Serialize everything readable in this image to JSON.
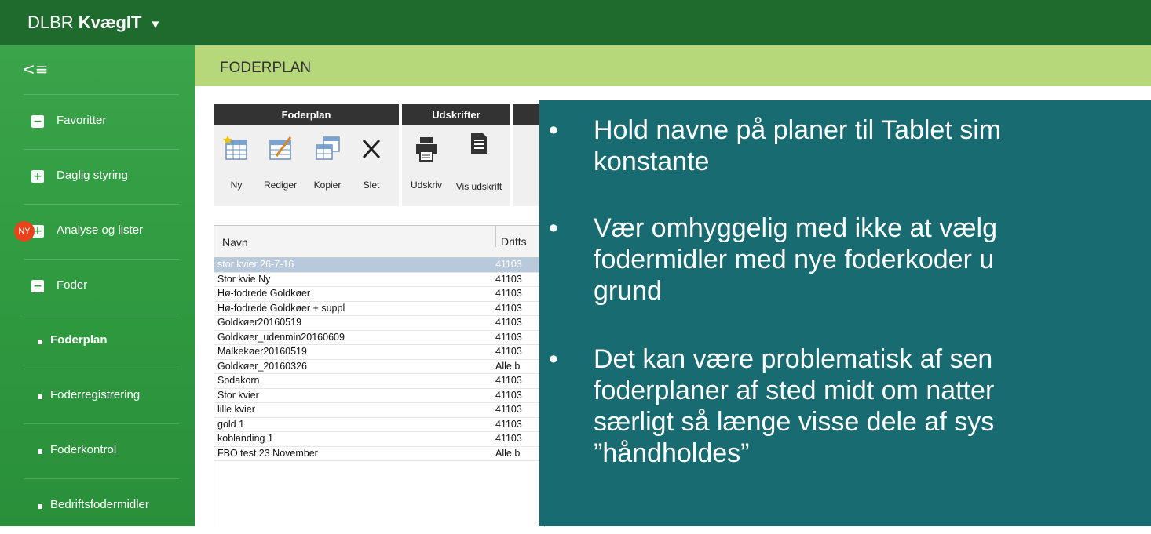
{
  "app": {
    "brand_light": "DLBR ",
    "brand_bold": "KvægIT",
    "brand_caret": "▼",
    "menu_toggle": "<≡"
  },
  "sidebar": {
    "badge": "NY",
    "items": [
      {
        "icon": "minus-box-icon",
        "glyph": "−",
        "label": "Favoritter"
      },
      {
        "icon": "plus-box-icon",
        "glyph": "+",
        "label": "Daglig styring"
      },
      {
        "icon": "plus-box-icon",
        "glyph": "+",
        "label": "Analyse og lister"
      },
      {
        "icon": "minus-box-icon",
        "glyph": "−",
        "label": "Foder"
      },
      {
        "label": "Foderplan",
        "active": true
      },
      {
        "label": "Foderregistrering"
      },
      {
        "label": "Foderkontrol"
      },
      {
        "label": "Bedriftsfodermidler"
      }
    ]
  },
  "page": {
    "title": "FODERPLAN"
  },
  "toolbar": {
    "group1": {
      "title": "Foderplan",
      "buttons": [
        "Ny",
        "Rediger",
        "Kopier",
        "Slet"
      ]
    },
    "group2": {
      "title": "Udskrifter",
      "buttons": [
        "Udskriv",
        "Vis udskrift"
      ]
    }
  },
  "grid": {
    "columns": [
      "Navn",
      "Drifts"
    ],
    "rows": [
      {
        "name": "stor kvier 26-7-16",
        "drift": "41103",
        "selected": true
      },
      {
        "name": "Stor kvie Ny",
        "drift": "41103"
      },
      {
        "name": "Hø-fodrede Goldkøer",
        "drift": "41103"
      },
      {
        "name": "Hø-fodrede Goldkøer + suppl",
        "drift": "41103"
      },
      {
        "name": "Goldkøer20160519",
        "drift": "41103"
      },
      {
        "name": "Goldkøer_udenmin20160609",
        "drift": "41103"
      },
      {
        "name": "Malkekøer20160519",
        "drift": "41103"
      },
      {
        "name": "Goldkøer_20160326",
        "drift": "Alle b"
      },
      {
        "name": "Sodakorn",
        "drift": "41103"
      },
      {
        "name": "Stor kvier",
        "drift": "41103"
      },
      {
        "name": "lille kvier",
        "drift": "41103"
      },
      {
        "name": "gold 1",
        "drift": "41103"
      },
      {
        "name": "koblanding 1",
        "drift": "41103"
      },
      {
        "name": "FBO test 23 November",
        "drift": "Alle b"
      }
    ]
  },
  "overlay": {
    "bullet": "•",
    "lines": [
      [
        "Hold navne på planer til Tablet sim",
        "konstante"
      ],
      [
        "Vær omhyggelig med ikke at vælg",
        "fodermidler med nye foderkoder u",
        "grund"
      ],
      [
        "Det kan være problematisk af sen",
        "foderplaner af sted midt om natter",
        "særligt så længe visse dele af sys",
        "”håndholdes”"
      ]
    ]
  },
  "colors": {
    "topbar": "#1f6b2e",
    "sidebar": "#2f9a40",
    "subheader": "#b6d77a",
    "overlay": "#196b72",
    "selected_row": "#b9c9dc"
  }
}
